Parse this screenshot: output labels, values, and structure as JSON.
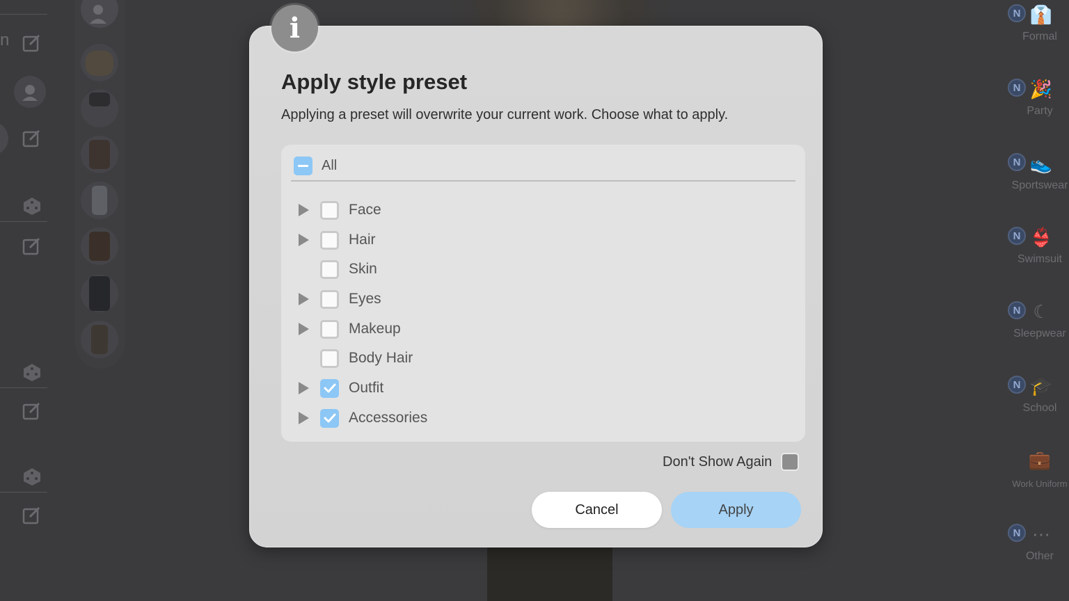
{
  "background": {
    "left_rail_fragment": "n",
    "style_categories": [
      {
        "badge": "N",
        "icon": "formal-icon",
        "label": "Formal"
      },
      {
        "badge": "N",
        "icon": "party-icon",
        "label": "Party"
      },
      {
        "badge": "N",
        "icon": "sportswear-icon",
        "label": "Sportswear"
      },
      {
        "badge": "N",
        "icon": "swimsuit-icon",
        "label": "Swimsuit"
      },
      {
        "badge": "N",
        "icon": "sleepwear-icon",
        "label": "Sleepwear"
      },
      {
        "badge": "N",
        "icon": "school-icon",
        "label": "School"
      },
      {
        "badge": "",
        "icon": "work-uniform-icon",
        "label": "Work Uniform"
      },
      {
        "badge": "N",
        "icon": "more-icon",
        "label": "Other"
      }
    ],
    "item_thumbnails": [
      "sweater",
      "shorts",
      "vest",
      "socks",
      "boots",
      "pants",
      "gloves"
    ]
  },
  "dialog": {
    "info_symbol": "i",
    "title": "Apply style preset",
    "subtitle": "Applying a preset will overwrite your current work. Choose what to apply.",
    "all": {
      "label": "All",
      "state": "partial"
    },
    "items": [
      {
        "label": "Face",
        "expandable": true,
        "checked": false
      },
      {
        "label": "Hair",
        "expandable": true,
        "checked": false
      },
      {
        "label": "Skin",
        "expandable": false,
        "checked": false
      },
      {
        "label": "Eyes",
        "expandable": true,
        "checked": false
      },
      {
        "label": "Makeup",
        "expandable": true,
        "checked": false
      },
      {
        "label": "Body Hair",
        "expandable": false,
        "checked": false
      },
      {
        "label": "Outfit",
        "expandable": true,
        "checked": true
      },
      {
        "label": "Accessories",
        "expandable": true,
        "checked": true
      }
    ],
    "dont_show_again": {
      "label": "Don't Show Again",
      "checked": false
    },
    "cancel_label": "Cancel",
    "apply_label": "Apply",
    "colors": {
      "accent": "#8cc7f6",
      "apply_button": "#a6d3f6"
    }
  }
}
